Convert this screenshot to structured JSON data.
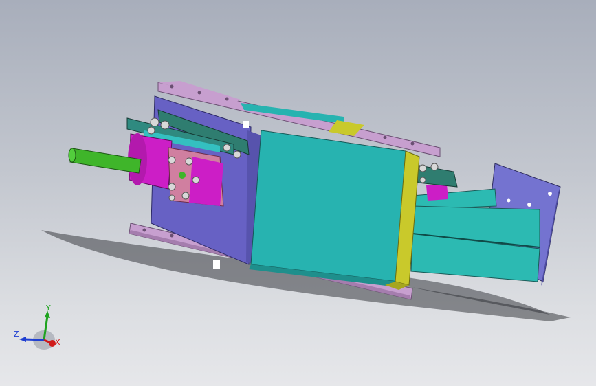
{
  "viewport": {
    "background_top": "#a8aebb",
    "background_bottom": "#e6e7ea"
  },
  "colors": {
    "flange": "#c79fcf",
    "flange_edge": "#6a4f72",
    "housing_face": "#27b3b0",
    "housing_side": "#6761c4",
    "gate_rail": "#c9c92b",
    "shaft": "#3fb52a",
    "motor_body": "#cc1ec6",
    "mount_plate": "#d07fa0",
    "bracket": "#2f7d70",
    "actuator_plate": "#7473d0",
    "actuator_rail": "#2cbab2"
  },
  "triad": {
    "x_label": "X",
    "y_label": "Y",
    "z_label": "Z",
    "x_color": "#d01a1a",
    "y_color": "#1fa31f",
    "z_color": "#1f3fd1"
  }
}
